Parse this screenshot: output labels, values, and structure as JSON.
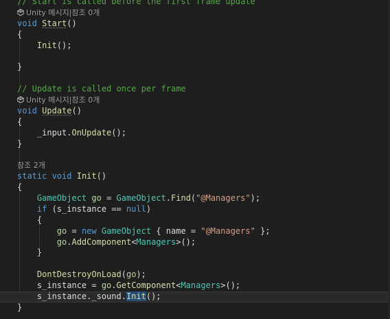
{
  "editor": {
    "lines": [
      {
        "tokens": [
          {
            "t": "// Start is called before the first frame update",
            "c": "cm"
          }
        ]
      },
      {
        "lens": true,
        "tokens": [
          {
            "t": "Unity 메시지|참조 0개",
            "c": "lens"
          }
        ]
      },
      {
        "tokens": [
          {
            "t": "void",
            "c": "kw"
          },
          {
            "t": " ",
            "c": "pl"
          },
          {
            "t": "Start",
            "c": "fn squiggle"
          },
          {
            "t": "()",
            "c": "pl"
          }
        ]
      },
      {
        "tokens": [
          {
            "t": "{",
            "c": "pl"
          }
        ]
      },
      {
        "tokens": [
          {
            "t": "    Init",
            "c": "fn"
          },
          {
            "t": "();",
            "c": "pl"
          }
        ]
      },
      {
        "tokens": []
      },
      {
        "tokens": [
          {
            "t": "}",
            "c": "pl"
          }
        ]
      },
      {
        "tokens": []
      },
      {
        "tokens": [
          {
            "t": "// Update is called once per frame",
            "c": "cm"
          }
        ]
      },
      {
        "lens": true,
        "tokens": [
          {
            "t": "Unity 메시지|참조 0개",
            "c": "lens"
          }
        ]
      },
      {
        "tokens": [
          {
            "t": "void",
            "c": "kw"
          },
          {
            "t": " ",
            "c": "pl"
          },
          {
            "t": "Update",
            "c": "fn squiggle"
          },
          {
            "t": "()",
            "c": "pl"
          }
        ]
      },
      {
        "tokens": [
          {
            "t": "{",
            "c": "pl"
          }
        ]
      },
      {
        "tokens": [
          {
            "t": "    _input.",
            "c": "pl"
          },
          {
            "t": "OnUpdate",
            "c": "fn"
          },
          {
            "t": "();",
            "c": "pl"
          }
        ]
      },
      {
        "tokens": [
          {
            "t": "}",
            "c": "pl"
          }
        ]
      },
      {
        "tokens": []
      },
      {
        "lens": true,
        "noicon": true,
        "tokens": [
          {
            "t": "참조 2개",
            "c": "lens"
          }
        ]
      },
      {
        "tokens": [
          {
            "t": "static",
            "c": "kw"
          },
          {
            "t": " ",
            "c": "pl"
          },
          {
            "t": "void",
            "c": "kw"
          },
          {
            "t": " ",
            "c": "pl"
          },
          {
            "t": "Init",
            "c": "fn"
          },
          {
            "t": "()",
            "c": "pl"
          }
        ]
      },
      {
        "tokens": [
          {
            "t": "{",
            "c": "pl"
          }
        ]
      },
      {
        "tokens": [
          {
            "t": "    ",
            "c": "pl"
          },
          {
            "t": "GameObject",
            "c": "type"
          },
          {
            "t": " ",
            "c": "pl"
          },
          {
            "t": "go",
            "c": "lp"
          },
          {
            "t": " = ",
            "c": "pl"
          },
          {
            "t": "GameObject",
            "c": "type"
          },
          {
            "t": ".",
            "c": "pl"
          },
          {
            "t": "Find",
            "c": "fn"
          },
          {
            "t": "(",
            "c": "pl"
          },
          {
            "t": "\"@Managers\"",
            "c": "str"
          },
          {
            "t": ");",
            "c": "pl"
          }
        ]
      },
      {
        "tokens": [
          {
            "t": "    ",
            "c": "pl"
          },
          {
            "t": "if",
            "c": "kw"
          },
          {
            "t": " (s_instance == ",
            "c": "pl"
          },
          {
            "t": "null",
            "c": "kw"
          },
          {
            "t": ")",
            "c": "pl"
          }
        ]
      },
      {
        "tokens": [
          {
            "t": "    {",
            "c": "pl"
          }
        ]
      },
      {
        "tokens": [
          {
            "t": "        ",
            "c": "pl"
          },
          {
            "t": "go",
            "c": "lp"
          },
          {
            "t": " = ",
            "c": "pl"
          },
          {
            "t": "new",
            "c": "kw"
          },
          {
            "t": " ",
            "c": "pl"
          },
          {
            "t": "GameObject",
            "c": "type"
          },
          {
            "t": " { name = ",
            "c": "pl"
          },
          {
            "t": "\"@Managers\"",
            "c": "str"
          },
          {
            "t": " };",
            "c": "pl"
          }
        ]
      },
      {
        "tokens": [
          {
            "t": "        ",
            "c": "pl"
          },
          {
            "t": "go",
            "c": "lp"
          },
          {
            "t": ".",
            "c": "pl"
          },
          {
            "t": "AddComponent",
            "c": "fn"
          },
          {
            "t": "<",
            "c": "pl"
          },
          {
            "t": "Managers",
            "c": "type"
          },
          {
            "t": ">();",
            "c": "pl"
          }
        ]
      },
      {
        "tokens": [
          {
            "t": "    }",
            "c": "pl"
          }
        ]
      },
      {
        "tokens": []
      },
      {
        "tokens": [
          {
            "t": "    ",
            "c": "pl"
          },
          {
            "t": "DontDestroyOnLoad",
            "c": "fn"
          },
          {
            "t": "(",
            "c": "pl"
          },
          {
            "t": "go",
            "c": "lp"
          },
          {
            "t": ");",
            "c": "pl"
          }
        ]
      },
      {
        "tokens": [
          {
            "t": "    s_instance = ",
            "c": "pl"
          },
          {
            "t": "go",
            "c": "lp"
          },
          {
            "t": ".",
            "c": "pl"
          },
          {
            "t": "GetComponent",
            "c": "fn"
          },
          {
            "t": "<",
            "c": "pl"
          },
          {
            "t": "Managers",
            "c": "type"
          },
          {
            "t": ">();",
            "c": "pl"
          }
        ]
      },
      {
        "current": true,
        "tokens": [
          {
            "t": "    s_instance._sound.",
            "c": "pl"
          },
          {
            "t": "Init",
            "c": "fn sel"
          },
          {
            "t": "();",
            "c": "pl"
          }
        ]
      },
      {
        "tokens": [
          {
            "t": "}",
            "c": "pl"
          }
        ]
      }
    ]
  }
}
